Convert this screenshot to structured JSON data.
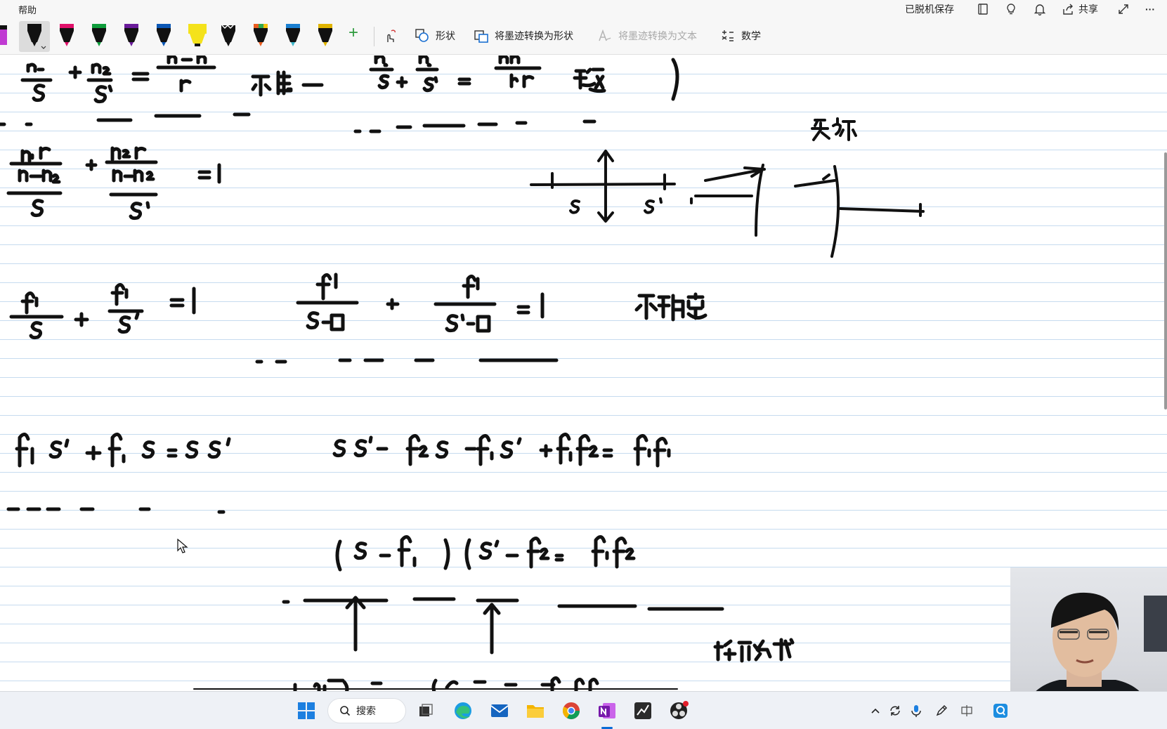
{
  "menu": {
    "help_label": "帮助"
  },
  "status": {
    "saved_offline": "已脱机保存",
    "share_label": "共享",
    "more_label": "···"
  },
  "ribbon": {
    "shapes_label": "形状",
    "ink_to_shape_label": "将墨迹转换为形状",
    "ink_to_text_label": "将墨迹转换为文本",
    "math_label": "数学",
    "add_pen_label": "+"
  },
  "pens": [
    {
      "name": "pen-black",
      "color": "#111111"
    },
    {
      "name": "pen-magenta",
      "color": "#e0106a"
    },
    {
      "name": "pen-green",
      "color": "#0f9d3c"
    },
    {
      "name": "pen-purple",
      "color": "#6a1b9a"
    },
    {
      "name": "pen-blue",
      "color": "#0b57b5"
    },
    {
      "name": "highlighter-yellow",
      "color": "#f4e21b"
    },
    {
      "name": "pen-galaxy",
      "color": "#2b2b2b"
    },
    {
      "name": "pen-rainbow",
      "color": "#e85d20"
    },
    {
      "name": "pen-ocean",
      "color": "#1a7fd1"
    },
    {
      "name": "pen-gold",
      "color": "#e0b400"
    }
  ],
  "taskbar": {
    "search_label": "搜索"
  },
  "icons": {
    "shapes": "shapes-icon",
    "ink_to_shape": "ink-to-shape-icon",
    "ink_to_text": "ink-to-text-icon",
    "math": "math-icon",
    "notebooks": "notebooks-icon",
    "lightbulb": "lightbulb-icon",
    "bell": "bell-icon",
    "share": "share-icon",
    "expand": "expand-icon"
  },
  "colors": {
    "accent": "#7719aa",
    "ink": "#111111",
    "rule_line": "#c6dbef"
  }
}
